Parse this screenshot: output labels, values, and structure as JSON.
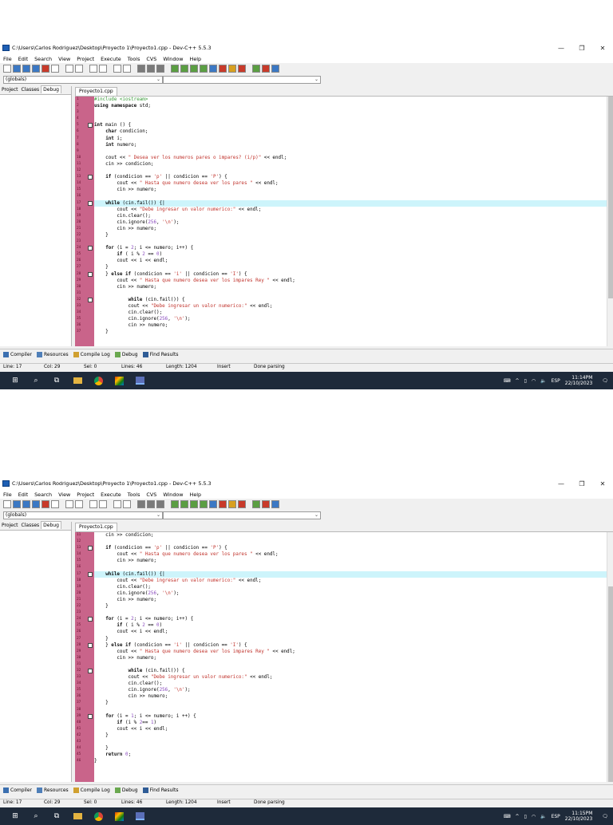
{
  "window": {
    "title": "C:\\Users\\Carlos Rodriguez\\Desktop\\Proyecto 1\\Proyecto1.cpp - Dev-C++ 5.5.3",
    "minimize_label": "—",
    "restore_label": "❐",
    "close_label": "✕"
  },
  "menu": [
    "File",
    "Edit",
    "Search",
    "View",
    "Project",
    "Execute",
    "Tools",
    "CVS",
    "Window",
    "Help"
  ],
  "combo": {
    "left": "(globals)",
    "right": ""
  },
  "left_tabs": [
    "Project",
    "Classes",
    "Debug"
  ],
  "editor_tab": "Proyecto1.cpp",
  "bottom_tabs": [
    "Compiler",
    "Resources",
    "Compile Log",
    "Debug",
    "Find Results"
  ],
  "status": {
    "line": "Line:   17",
    "col": "Col:   29",
    "sel": "Sel:   0",
    "lines": "Lines:   46",
    "length": "Length:   1204",
    "mode": "Insert",
    "message": "Done parsing"
  },
  "tray": {
    "lang": "ESP",
    "up_arrow": "^",
    "sound": "🔈"
  },
  "shot1": {
    "clock_time": "11:14PM",
    "clock_date": "22/10/2023"
  },
  "shot2": {
    "clock_time": "11:15PM",
    "clock_date": "22/10/2023"
  },
  "code_lines": [
    "#include <iostream>",
    "using namespace std;",
    "",
    "",
    "int main () {",
    "    char condicion;",
    "    int i;",
    "    int numero;",
    "",
    "    cout << \" Desea ver los numeros pares o impares? (i/p)\" << endl;",
    "    cin >> condicion;",
    "",
    "    if (condicion == 'p' || condicion == 'P') {",
    "        cout << \" Hasta que numero desea ver los pares \" << endl;",
    "        cin >> numero;",
    "",
    "    while (cin.fail()) {|",
    "        cout << \"Debe ingresar un valor numerico:\" << endl;",
    "        cin.clear();",
    "        cin.ignore(256, '\\n');",
    "        cin >> numero;",
    "    }",
    "",
    "    for (i = 2; i <= numero; i++) {",
    "        if ( i % 2 == 0)",
    "        cout << i << endl;",
    "    }",
    "    } else if (condicion == 'i' || condicion == 'I') {",
    "        cout << \" Hasta que numero desea ver los impares Rey \" << endl;",
    "        cin >> numero;",
    "",
    "            while (cin.fail()) {",
    "            cout << \"Debe ingresar un valor numerico:\" << endl;",
    "            cin.clear();",
    "            cin.ignore(256, '\\n');",
    "            cin >> numero;",
    "    }",
    "",
    "    for (i = 1; i <= numero; i ++) {",
    "        if (i % 2== 1)",
    "        cout << i << endl;",
    "    }",
    "",
    "    }",
    "    return 0;",
    "}"
  ],
  "shot1_range": [
    1,
    37
  ],
  "shot2_range": [
    11,
    46
  ],
  "highlight_line": 17,
  "fold_lines": [
    5,
    13,
    17,
    24,
    28,
    32,
    39
  ],
  "colors": {
    "gutter": "#c9648a",
    "highlight": "#cdf4fb",
    "taskbar": "#1e2a3a"
  }
}
